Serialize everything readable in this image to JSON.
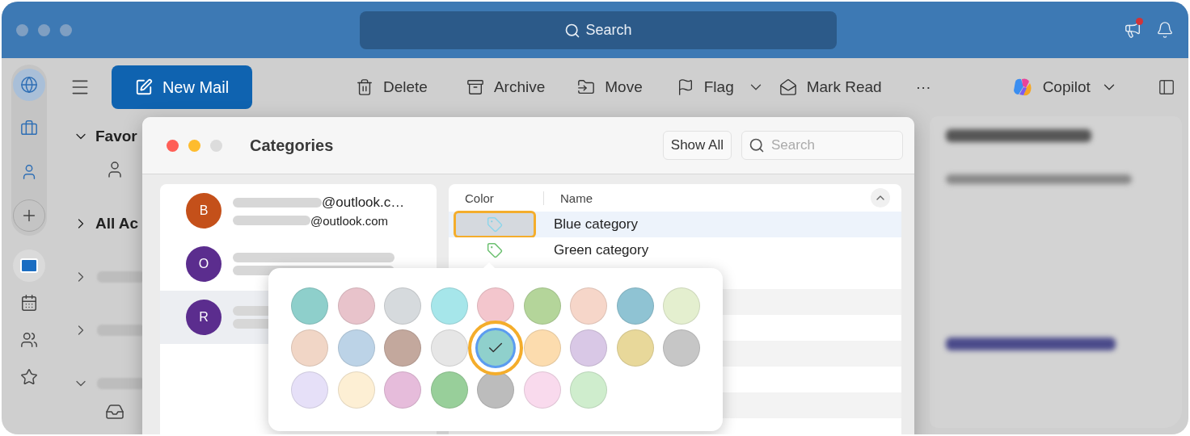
{
  "title_bar": {
    "search": {
      "placeholder": "Search"
    },
    "notification_badge": true
  },
  "rail": [
    {
      "selected": true
    },
    {
      "selected": false
    },
    {
      "selected": false
    },
    {
      "selected": false
    },
    {
      "selected": true
    },
    {
      "selected": false
    },
    {
      "selected": false
    },
    {
      "selected": false
    }
  ],
  "toolbar": {
    "new_mail": "New Mail",
    "actions": [
      {
        "label": "Delete",
        "dropdown": false
      },
      {
        "label": "Archive",
        "dropdown": false
      },
      {
        "label": "Move",
        "dropdown": false
      },
      {
        "label": "Flag",
        "dropdown": true
      },
      {
        "label": "Mark Read",
        "dropdown": false
      }
    ],
    "more": "···",
    "copilot": "Copilot"
  },
  "folder_pane": {
    "sections": [
      {
        "label": "Favor",
        "expanded": true
      },
      {
        "label": "All Ac",
        "expanded": false
      }
    ],
    "folders": [
      {
        "expanded": false
      },
      {
        "expanded": false
      },
      {
        "expanded": true
      }
    ]
  },
  "dialog": {
    "title": "Categories",
    "show_all": "Show All",
    "search": {
      "placeholder": "Search"
    },
    "accounts": [
      {
        "initial": "B",
        "color": "#c4501a",
        "email": "@outlook.c…",
        "secondary": "@outlook.com",
        "selected": false
      },
      {
        "initial": "O",
        "color": "#5b2d8e",
        "selected": false
      },
      {
        "initial": "R",
        "color": "#5b2d8e",
        "selected": true
      }
    ],
    "columns": [
      "Color",
      "Name"
    ],
    "categories": [
      {
        "name": "Blue category",
        "color": "#8fd6ea",
        "selected": true
      },
      {
        "name": "Green category",
        "color": "#6cc070",
        "selected": false
      }
    ],
    "palette": [
      {
        "color": "#8ecfcb",
        "selected": false
      },
      {
        "color": "#e8c3cb",
        "selected": false
      },
      {
        "color": "#d6dadd",
        "selected": false
      },
      {
        "color": "#a6e6ea",
        "selected": false
      },
      {
        "color": "#f3c6cd",
        "selected": false
      },
      {
        "color": "#b4d59a",
        "selected": false
      },
      {
        "color": "#f6d6c9",
        "selected": false
      },
      {
        "color": "#8fc3d3",
        "selected": false
      },
      {
        "color": "#e4efcf",
        "selected": false
      },
      {
        "color": "#f1d6c6",
        "selected": false
      },
      {
        "color": "#bcd3e7",
        "selected": false
      },
      {
        "color": "#c3a89d",
        "selected": false
      },
      {
        "color": "#e6e6e6",
        "selected": false
      },
      {
        "color": "#8fd0cc",
        "selected": true
      },
      {
        "color": "#fcdcae",
        "selected": false
      },
      {
        "color": "#d9c8e6",
        "selected": false
      },
      {
        "color": "#e8d89a",
        "selected": false
      },
      {
        "color": "#c6c6c6",
        "selected": false
      },
      {
        "color": "#e6e0f8",
        "selected": false
      },
      {
        "color": "#fdefd4",
        "selected": false
      },
      {
        "color": "#e6bcdb",
        "selected": false
      },
      {
        "color": "#98cf9a",
        "selected": false
      },
      {
        "color": "#bcbcbc",
        "selected": false
      },
      {
        "color": "#f9daed",
        "selected": false
      },
      {
        "color": "#cfedcd",
        "selected": false
      }
    ]
  }
}
